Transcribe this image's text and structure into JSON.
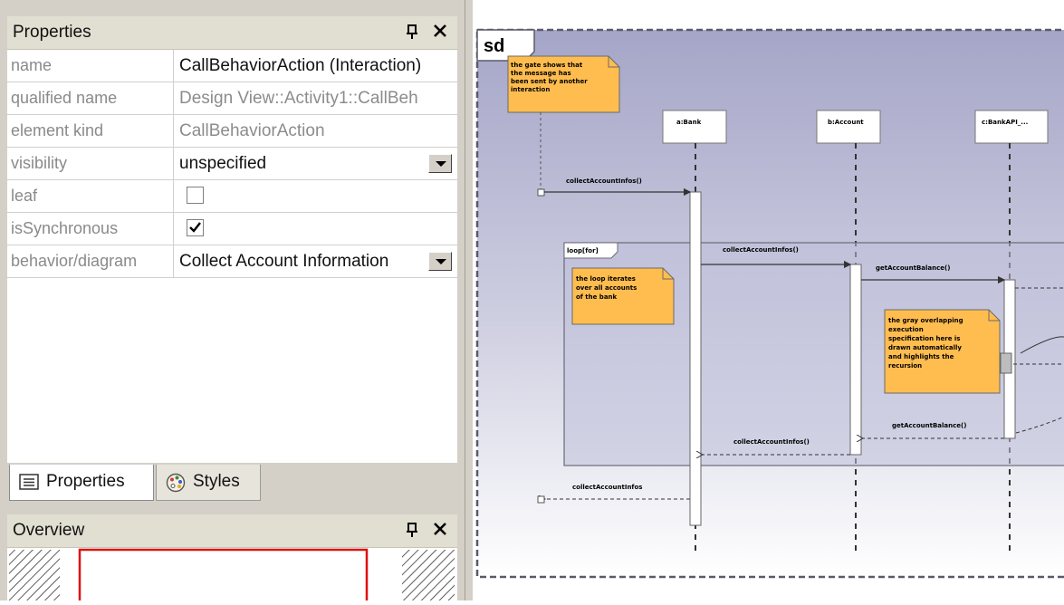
{
  "properties_panel": {
    "title": "Properties",
    "rows": [
      {
        "name": "name",
        "value": "CallBehaviorAction (Interaction)"
      },
      {
        "name": "qualified name",
        "value": "Design View::Activity1::CallBeh"
      },
      {
        "name": "element kind",
        "value": "CallBehaviorAction"
      },
      {
        "name": "visibility",
        "value": "unspecified"
      },
      {
        "name": "leaf",
        "checked": false
      },
      {
        "name": "isSynchronous",
        "checked": true
      },
      {
        "name": "behavior/diagram",
        "value": "Collect Account Information"
      }
    ],
    "tabs": [
      {
        "label": "Properties",
        "active": true
      },
      {
        "label": "Styles",
        "active": false
      }
    ]
  },
  "overview_panel": {
    "title": "Overview"
  },
  "diagram": {
    "frame_label": "sd",
    "lifelines": [
      {
        "label": "a:Bank"
      },
      {
        "label": "b:Account"
      },
      {
        "label": "c:BankAPI_..."
      }
    ],
    "fragment_label": "loop[for]",
    "notes": [
      "the gate shows that the message has been sent by another interaction",
      "the loop iterates over all accounts of the bank",
      "the gray overlapping execution specification here is drawn automatically and highlights the recursion"
    ],
    "messages": [
      "collectAccountInfos()",
      "collectAccountInfos()",
      "getAccountBalance()",
      "getAccountBalance()",
      "collectAccountInfos()",
      "collectAccountInfos"
    ],
    "colors": {
      "note_fill": "#ffbd4f",
      "frame_fill_top": "#a5a5c8",
      "frame_fill_bottom": "#ffffff",
      "frame_border": "#5a5a6a"
    }
  }
}
